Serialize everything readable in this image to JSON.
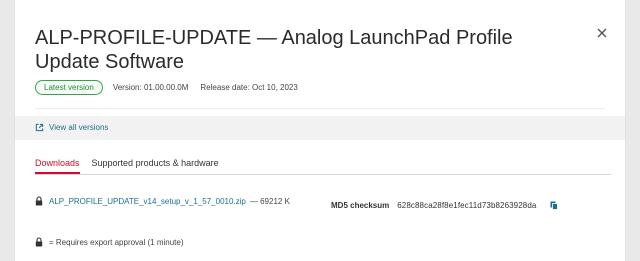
{
  "dialog": {
    "title": "ALP-PROFILE-UPDATE — Analog LaunchPad Profile Update Software",
    "badge": "Latest version",
    "version": "Version: 01.00.00.0M",
    "release_date": "Release date: Oct 10, 2023",
    "view_all_versions": "View all versions",
    "tabs": [
      {
        "label": "Downloads",
        "active": true
      },
      {
        "label": "Supported products & hardware",
        "active": false
      }
    ],
    "download": {
      "file_name": "ALP_PROFILE_UPDATE_v14_setup_v_1_57_0010.zip",
      "size": "— 69212 K",
      "md5_label": "MD5 checksum",
      "md5_value": "628c88ca28f8e1fec11d73b8263928da"
    },
    "note": "= Requires export approval (1 minute)"
  },
  "colors": {
    "accent_red": "#c8102e",
    "link_teal": "#1d6f8c",
    "badge_green": "#3aa14a"
  },
  "icons": [
    "close-icon",
    "external-link-icon",
    "lock-icon",
    "copy-icon"
  ]
}
